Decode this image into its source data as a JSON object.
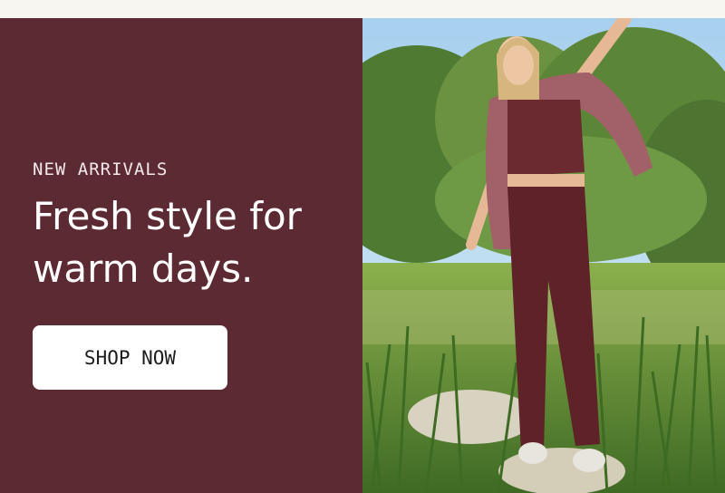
{
  "hero": {
    "eyebrow": "NEW ARRIVALS",
    "headline": "Fresh style for warm days.",
    "cta_label": "SHOP NOW"
  },
  "colors": {
    "promo_background": "#5c2a33",
    "button_background": "#ffffff",
    "page_background": "#f8f6f1"
  }
}
